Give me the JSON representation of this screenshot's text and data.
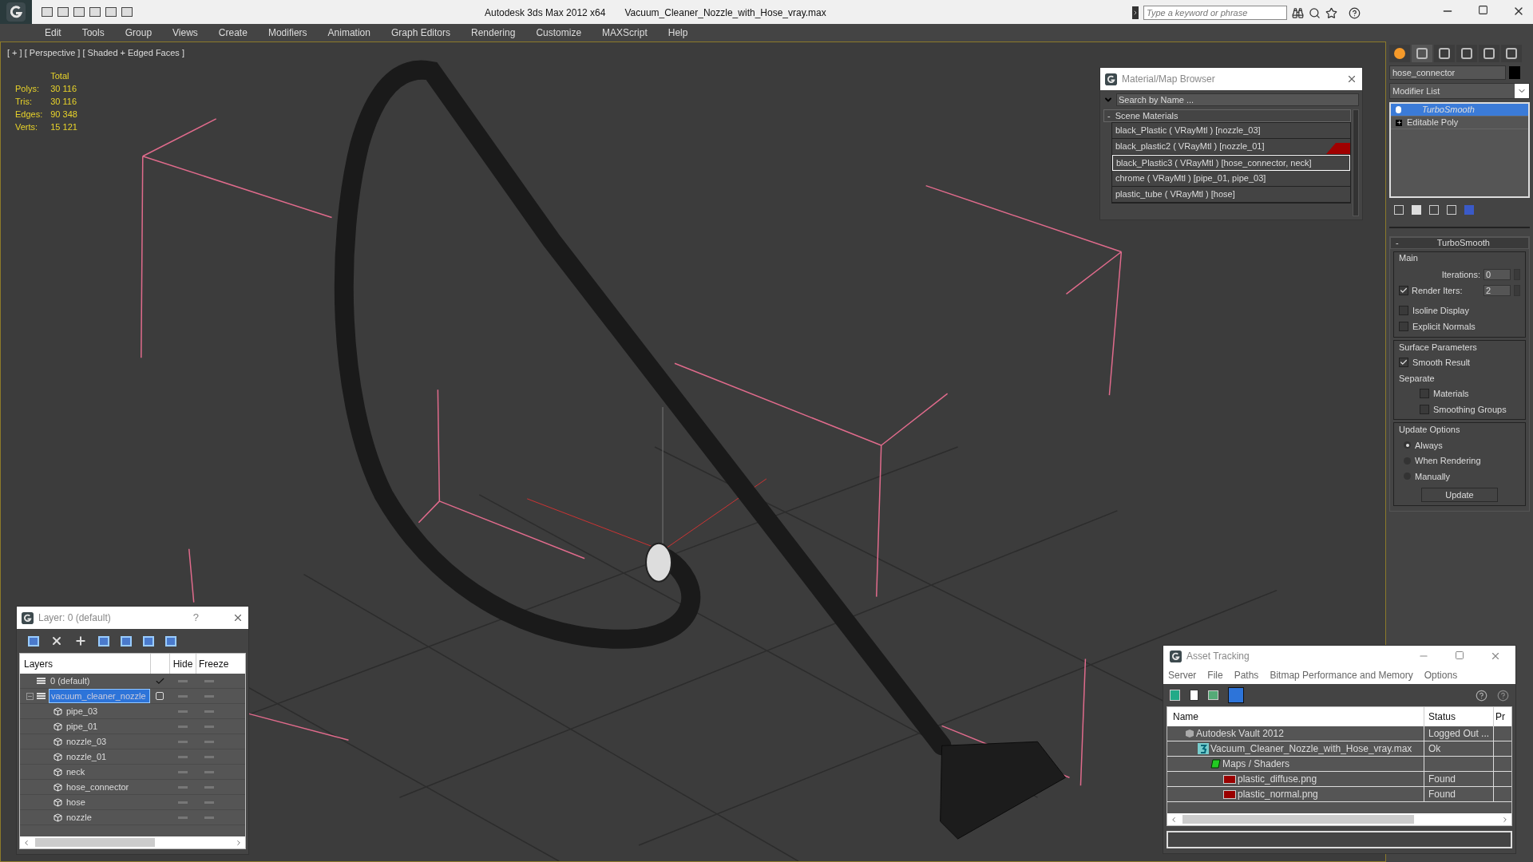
{
  "title_bar": {
    "app": "Autodesk 3ds Max  2012 x64",
    "file": "Vacuum_Cleaner_Nozzle_with_Hose_vray.max",
    "search_placeholder": "Type a keyword or phrase"
  },
  "menu": [
    "Edit",
    "Tools",
    "Group",
    "Views",
    "Create",
    "Modifiers",
    "Animation",
    "Graph Editors",
    "Rendering",
    "Customize",
    "MAXScript",
    "Help"
  ],
  "viewport": {
    "label": "[ + ] [ Perspective ] [ Shaded + Edged Faces ]",
    "stats_heading": "Total",
    "stats": [
      {
        "label": "Polys:",
        "value": "30 116"
      },
      {
        "label": "Tris:",
        "value": "30 116"
      },
      {
        "label": "Edges:",
        "value": "90 348"
      },
      {
        "label": "Verts:",
        "value": "15 121"
      }
    ]
  },
  "material_browser": {
    "title": "Material/Map Browser",
    "search_placeholder": "Search by Name ...",
    "group_toggle": "-",
    "group": "Scene Materials",
    "items": [
      {
        "label": "black_Plastic  ( VRayMtl ) [nozzle_03]",
        "selected": false,
        "flagged": false
      },
      {
        "label": "black_plastic2  ( VRayMtl ) [nozzle_01]",
        "selected": false,
        "flagged": true
      },
      {
        "label": "black_Plastic3  ( VRayMtl ) [hose_connector, neck]",
        "selected": true,
        "flagged": false
      },
      {
        "label": "chrome  ( VRayMtl ) [pipe_01, pipe_03]",
        "selected": false,
        "flagged": false
      },
      {
        "label": "plastic_tube  ( VRayMtl ) [hose]",
        "selected": false,
        "flagged": false
      }
    ]
  },
  "command_panel": {
    "object_name": "hose_connector",
    "modifier_list": "Modifier List",
    "stack": [
      {
        "label": "TurboSmooth",
        "selected": true,
        "kind": "modifier"
      },
      {
        "label": "Editable Poly",
        "selected": false,
        "kind": "base"
      }
    ],
    "rollout_toggle": "-",
    "rollout_title": "TurboSmooth",
    "main_label": "Main",
    "iterations": {
      "label": "Iterations:",
      "value": "0"
    },
    "render_iters": {
      "label": "Render Iters:",
      "value": "2",
      "checked": true
    },
    "isoline": {
      "label": "Isoline Display",
      "checked": false
    },
    "explicit_normals": {
      "label": "Explicit Normals",
      "checked": false
    },
    "surface_label": "Surface Parameters",
    "smooth_result": {
      "label": "Smooth Result",
      "checked": true
    },
    "separate_label": "Separate",
    "materials": {
      "label": "Materials",
      "checked": false
    },
    "smoothing_groups": {
      "label": "Smoothing Groups",
      "checked": false
    },
    "update_label": "Update Options",
    "update_options": [
      {
        "label": "Always",
        "selected": true
      },
      {
        "label": "When Rendering",
        "selected": false
      },
      {
        "label": "Manually",
        "selected": false
      }
    ],
    "update_button": "Update"
  },
  "layer_window": {
    "title": "Layer: 0 (default)",
    "help": "?",
    "columns": [
      "Layers",
      "Hide",
      "Freeze"
    ],
    "rows": [
      {
        "name": "0 (default)",
        "kind": "layer",
        "current": true,
        "selected": false
      },
      {
        "name": "vacuum_cleaner_nozzle",
        "kind": "layer",
        "current": false,
        "selected": true,
        "expanded": true,
        "children": [
          {
            "name": "pipe_03",
            "kind": "object"
          },
          {
            "name": "pipe_01",
            "kind": "object"
          },
          {
            "name": "nozzle_03",
            "kind": "object"
          },
          {
            "name": "nozzle_01",
            "kind": "object"
          },
          {
            "name": "neck",
            "kind": "object"
          },
          {
            "name": "hose_connector",
            "kind": "object"
          },
          {
            "name": "hose",
            "kind": "object"
          },
          {
            "name": "nozzle",
            "kind": "object"
          }
        ]
      }
    ]
  },
  "asset_tracking": {
    "title": "Asset Tracking",
    "menu": [
      "Server",
      "File",
      "Paths",
      "Bitmap Performance and Memory",
      "Options"
    ],
    "columns": [
      "Name",
      "Status",
      "Pr"
    ],
    "rows": [
      {
        "name": "Autodesk Vault 2012",
        "kind": "vault",
        "status": "Logged Out ...",
        "children": [
          {
            "name": "Vacuum_Cleaner_Nozzle_with_Hose_vray.max",
            "kind": "scene",
            "status": "Ok",
            "children": [
              {
                "name": "Maps / Shaders",
                "kind": "folder",
                "children": [
                  {
                    "name": "plastic_diffuse.png",
                    "kind": "png",
                    "status": "Found"
                  },
                  {
                    "name": "plastic_normal.png",
                    "kind": "png",
                    "status": "Found"
                  }
                ]
              }
            ]
          }
        ]
      }
    ]
  }
}
